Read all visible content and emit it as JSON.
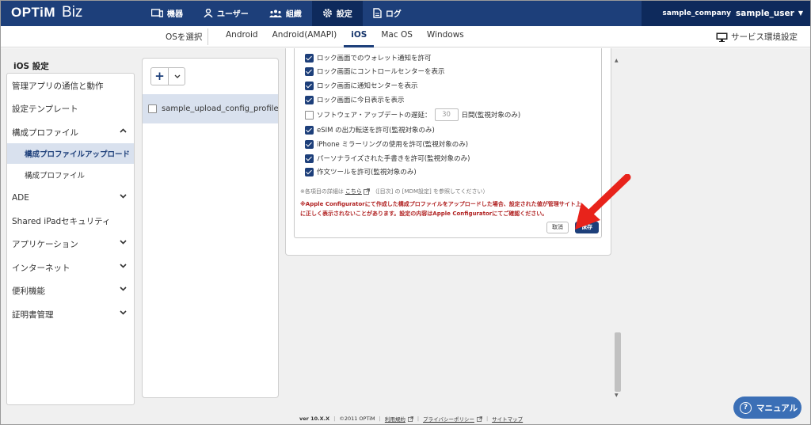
{
  "header": {
    "logo_brand": "OPTiM",
    "logo_suffix": "Biz",
    "nav": [
      {
        "label": "機器",
        "icon": "device-icon"
      },
      {
        "label": "ユーザー",
        "icon": "user-icon"
      },
      {
        "label": "組織",
        "icon": "organization-icon"
      },
      {
        "label": "設定",
        "icon": "gear-icon",
        "active": true
      },
      {
        "label": "ログ",
        "icon": "log-icon"
      }
    ],
    "company": "sample_company",
    "user": "sample_user"
  },
  "os_bar": {
    "select_label": "OSを選択",
    "tabs": [
      "Android",
      "Android(AMAPI)",
      "iOS",
      "Mac OS",
      "Windows"
    ],
    "active_tab": "iOS",
    "service_env_label": "サービス環境設定"
  },
  "page_title": "iOS 設定",
  "sidebar": {
    "items": [
      {
        "label": "管理アプリの通信と動作"
      },
      {
        "label": "設定テンプレート"
      },
      {
        "label": "構成プロファイル",
        "expanded": true
      },
      {
        "label": "構成プロファイルアップロード",
        "active": true
      },
      {
        "label": "構成プロファイル"
      },
      {
        "label": "ADE"
      },
      {
        "label": "Shared iPadセキュリティ"
      },
      {
        "label": "アプリケーション"
      },
      {
        "label": "インターネット"
      },
      {
        "label": "便利機能"
      },
      {
        "label": "証明書管理"
      }
    ]
  },
  "list": {
    "add_label": "+",
    "items": [
      "sample_upload_config_profile"
    ]
  },
  "settings": {
    "rows": [
      {
        "label": "ロック画面でのウォレット通知を許可",
        "checked": true
      },
      {
        "label": "ロック画面にコントロールセンターを表示",
        "checked": true
      },
      {
        "label": "ロック画面に通知センターを表示",
        "checked": true
      },
      {
        "label": "ロック画面に今日表示を表示",
        "checked": true
      },
      {
        "label": "ソフトウェア・アップデートの遅延：",
        "checked": false,
        "input_placeholder": "30",
        "suffix": "日間(監視対象のみ)"
      },
      {
        "label": "eSIM の出力転送を許可(監視対象のみ)",
        "checked": true
      },
      {
        "label": "iPhone ミラーリングの使用を許可(監視対象のみ)",
        "checked": true
      },
      {
        "label": "パーソナライズされた手書きを許可(監視対象のみ)",
        "checked": true
      },
      {
        "label": "作文ツールを許可(監視対象のみ)",
        "checked": true
      }
    ],
    "note_prefix": "※各項目の詳細は",
    "note_link": "こちら",
    "note_suffix": "（[目次] の [MDM設定] を参照してください）",
    "warning_line1": "※Apple Configuratorにて作成した構成プロファイルをアップロードした場合、設定された値が管理サイト上",
    "warning_line2": "に正しく表示されないことがあります。設定の内容はApple Configuratorにてご確認ください。",
    "cancel_label": "取消",
    "save_label": "保存"
  },
  "footer": {
    "version": "ver 10.X.X",
    "copyright": "©2011 OPTiM",
    "terms": "利用規約",
    "privacy": "プライバシーポリシー",
    "sitemap": "サイトマップ"
  },
  "manual_label": "マニュアル",
  "colors": {
    "header": "#1d3f7a",
    "accent": "#1d3f7a",
    "warning": "#b02020",
    "arrow": "#e8231b"
  }
}
